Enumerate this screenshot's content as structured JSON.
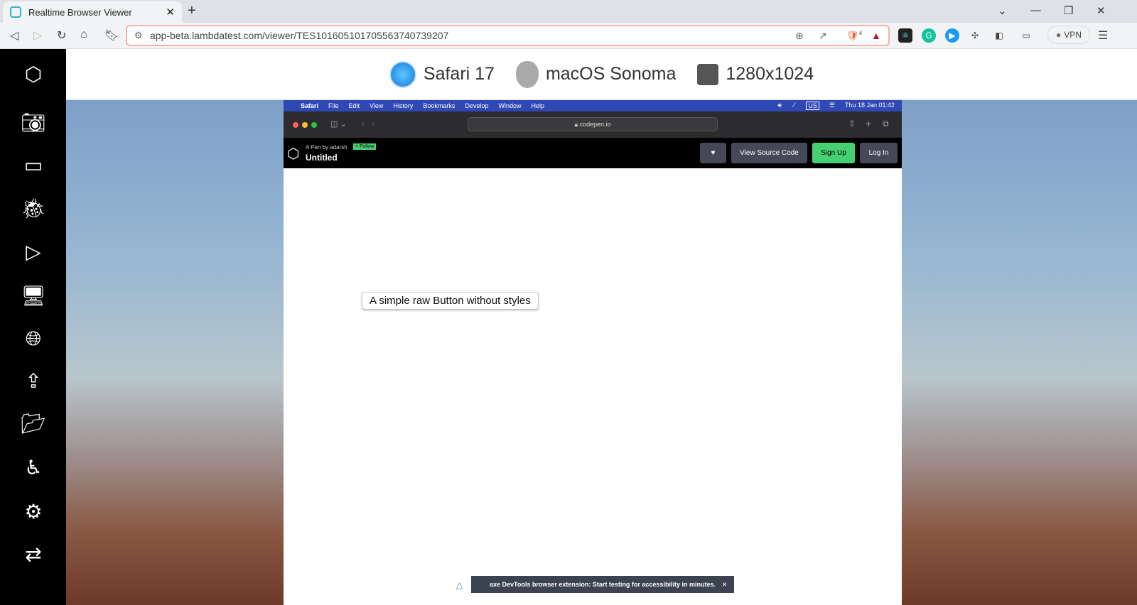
{
  "browser": {
    "tab_title": "Realtime Browser Viewer",
    "url": "app-beta.lambdatest.com/viewer/TES101605101705563740739207",
    "brave_badge": "4",
    "vpn_label": "VPN"
  },
  "header": {
    "browser": "Safari 17",
    "os": "macOS Sonoma",
    "resolution": "1280x1024"
  },
  "mac": {
    "menu": [
      "Safari",
      "File",
      "Edit",
      "View",
      "History",
      "Bookmarks",
      "Develop",
      "Window",
      "Help"
    ],
    "kbd": "US",
    "datetime": "Thu 18 Jan  01:42",
    "site": "codepen.io"
  },
  "codepen": {
    "byline": "A Pen by adarsh",
    "follow": "+ Follow",
    "title": "Untitled",
    "view_source": "View Source Code",
    "signup": "Sign Up",
    "login": "Log In"
  },
  "page": {
    "button": "A simple raw Button without styles",
    "axe_banner": "axe DevTools browser extension: Start testing for accessibility in minutes.",
    "axe_close": "×"
  }
}
